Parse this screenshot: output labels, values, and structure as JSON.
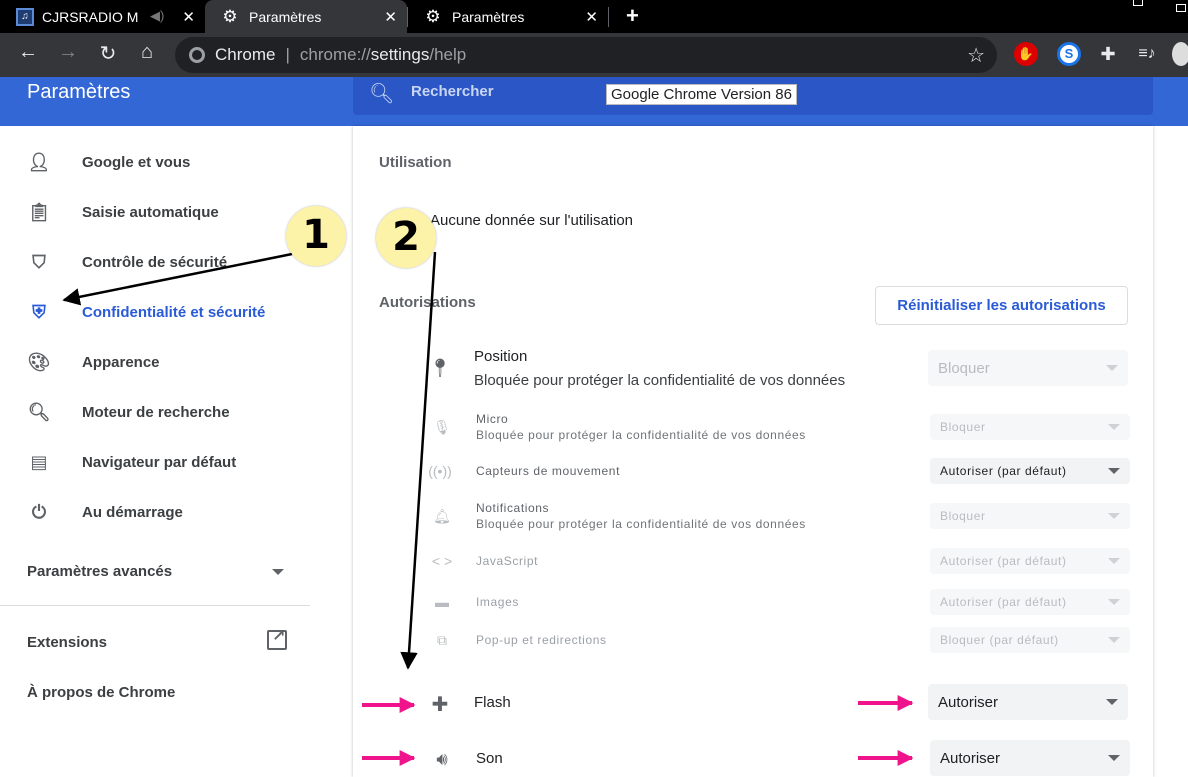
{
  "tabs": [
    {
      "label": "CJRSRADIO M",
      "icon": "radio-favicon-icon"
    },
    {
      "label": "Paramètres",
      "icon": "gear-icon"
    },
    {
      "label": "Paramètres",
      "icon": "gear-icon"
    }
  ],
  "omnibox": {
    "site": "Chrome",
    "url_scheme": "chrome://",
    "url_host": "settings",
    "url_path": "/help"
  },
  "header": {
    "title": "Paramètres",
    "search_placeholder": "Rechercher",
    "version_tooltip": "Google Chrome  Version 86"
  },
  "sidebar": {
    "items": [
      {
        "label": "Google et vous",
        "icon": "person-icon"
      },
      {
        "label": "Saisie automatique",
        "icon": "clipboard-icon"
      },
      {
        "label": "Contrôle de sécurité",
        "icon": "shield-check-icon"
      },
      {
        "label": "Confidentialité et sécurité",
        "icon": "shield-icon"
      },
      {
        "label": "Apparence",
        "icon": "palette-icon"
      },
      {
        "label": "Moteur de recherche",
        "icon": "search-icon"
      },
      {
        "label": "Navigateur par défaut",
        "icon": "browser-icon"
      },
      {
        "label": "Au démarrage",
        "icon": "power-icon"
      }
    ],
    "advanced": "Paramètres avancés",
    "extensions": "Extensions",
    "about": "À propos de Chrome"
  },
  "main": {
    "usage_title": "Utilisation",
    "usage_text": "Aucune donnée sur l'utilisation",
    "permissions_title": "Autorisations",
    "reset_button": "Réinitialiser les autorisations",
    "permissions": [
      {
        "name": "Position",
        "desc": "Bloquée pour protéger la confidentialité de vos données",
        "value": "Bloquer",
        "icon": "location-pin-icon"
      },
      {
        "name": "Micro",
        "desc": "Bloquée pour protéger la confidentialité de vos données",
        "value": "Bloquer",
        "icon": "microphone-icon"
      },
      {
        "name": "Capteurs de mouvement",
        "desc": "",
        "value": "Autoriser (par défaut)",
        "icon": "motion-sensor-icon"
      },
      {
        "name": "Notifications",
        "desc": "Bloquée pour protéger la confidentialité de vos données",
        "value": "Bloquer",
        "icon": "bell-icon"
      },
      {
        "name": "JavaScript",
        "desc": "",
        "value": "Autoriser (par défaut)",
        "icon": "code-icon"
      },
      {
        "name": "Images",
        "desc": "",
        "value": "Autoriser (par défaut)",
        "icon": "image-icon"
      },
      {
        "name": "Pop-up et redirections",
        "desc": "",
        "value": "Bloquer (par défaut)",
        "icon": "popup-icon"
      },
      {
        "name": "Flash",
        "desc": "",
        "value": "Autoriser",
        "icon": "puzzle-icon"
      },
      {
        "name": "Son",
        "desc": "",
        "value": "Autoriser",
        "icon": "speaker-icon"
      }
    ]
  },
  "annotations": {
    "badge1": "1",
    "badge2": "2",
    "arrow_color": "#000000",
    "pink_arrow_color": "#f0148c",
    "badge_color": "#fdf3a8"
  },
  "colors": {
    "header": "#3367d6",
    "accent": "#2a5bd7",
    "tab_bar": "#000000",
    "toolbar": "#35363a"
  }
}
